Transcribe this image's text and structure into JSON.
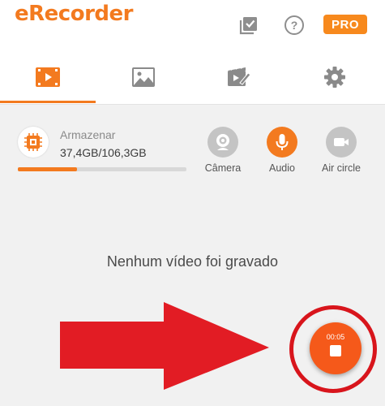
{
  "header": {
    "app_title": "eRecorder",
    "pro_badge": "PRO",
    "icons": [
      "checklist-icon",
      "help-icon"
    ]
  },
  "tabs": [
    {
      "name": "videos",
      "icon": "video-icon",
      "active": true
    },
    {
      "name": "images",
      "icon": "image-icon",
      "active": false
    },
    {
      "name": "editor",
      "icon": "video-edit-icon",
      "active": false
    },
    {
      "name": "settings",
      "icon": "gear-icon",
      "active": false
    }
  ],
  "storage": {
    "label": "Armazenar",
    "value": "37,4GB/106,3GB",
    "used_fraction": 0.352
  },
  "sources": [
    {
      "label": "Câmera",
      "icon": "webcam-icon",
      "active": false
    },
    {
      "label": "Audio",
      "icon": "microphone-icon",
      "active": true
    },
    {
      "label": "Air circle",
      "icon": "video-camera-icon",
      "active": false
    }
  ],
  "empty_message": "Nenhum vídeo foi gravado",
  "recorder": {
    "elapsed": "00:05",
    "icon": "stop-icon"
  },
  "colors": {
    "accent": "#f37a1f",
    "pro_badge": "#f7891d",
    "record_button": "#f5591a",
    "annotation_red": "#d8151c",
    "inactive_icon": "#c4c4c4"
  }
}
